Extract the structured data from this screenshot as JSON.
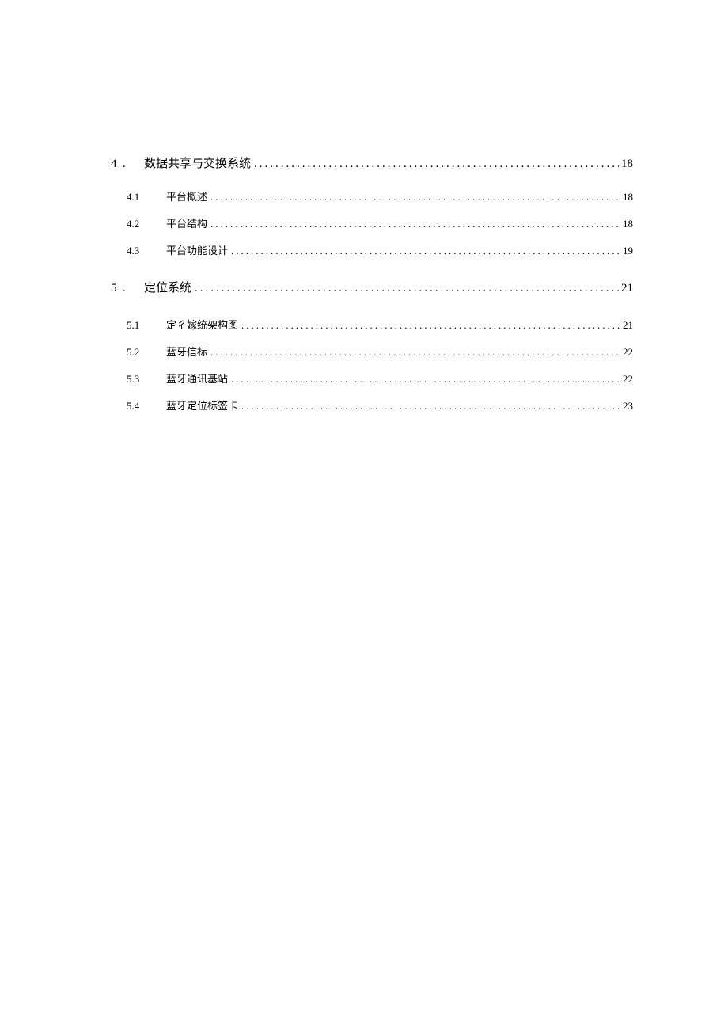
{
  "toc": {
    "sections": [
      {
        "number": "4",
        "prefix": ".",
        "title": "数据共享与交换系统",
        "page": "18",
        "subs": [
          {
            "number": "4.1",
            "title": "平台概述",
            "page": "18"
          },
          {
            "number": "4.2",
            "title": "平台结构",
            "page": "18"
          },
          {
            "number": "4.3",
            "title": "平台功能设计",
            "page": "19"
          }
        ]
      },
      {
        "number": "5",
        "prefix": ".",
        "title": "定位系统",
        "page": "21",
        "subs": [
          {
            "number": "5.1",
            "title": "定彳嫁统架构图",
            "page": "21"
          },
          {
            "number": "5.2",
            "title": "蓝牙信标",
            "page": "22"
          },
          {
            "number": "5.3",
            "title": "蓝牙通讯基站",
            "page": "22"
          },
          {
            "number": "5.4",
            "title": "蓝牙定位标签卡",
            "page": "23"
          }
        ]
      }
    ]
  }
}
